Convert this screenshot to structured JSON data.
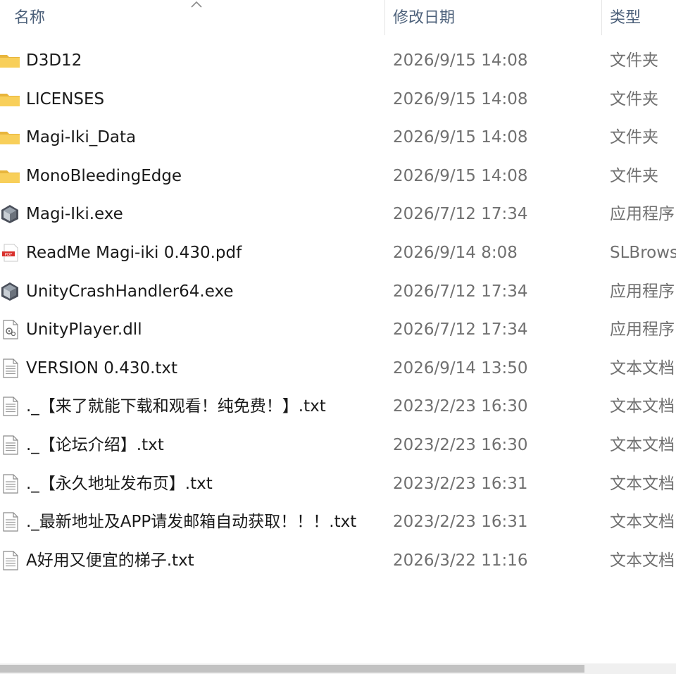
{
  "header": {
    "name_label": "名称",
    "date_label": "修改日期",
    "type_label": "类型",
    "sort_indicator": "chevron-up-icon"
  },
  "files": [
    {
      "name": "D3D12",
      "date": "2026/9/15 14:08",
      "type": "文件夹",
      "icon": "folder"
    },
    {
      "name": "LICENSES",
      "date": "2026/9/15 14:08",
      "type": "文件夹",
      "icon": "folder"
    },
    {
      "name": "Magi-Iki_Data",
      "date": "2026/9/15 14:08",
      "type": "文件夹",
      "icon": "folder"
    },
    {
      "name": "MonoBleedingEdge",
      "date": "2026/9/15 14:08",
      "type": "文件夹",
      "icon": "folder"
    },
    {
      "name": "Magi-Iki.exe",
      "date": "2026/7/12 17:34",
      "type": "应用程序",
      "icon": "unity-exe"
    },
    {
      "name": "ReadMe Magi-iki 0.430.pdf",
      "date": "2026/9/14 8:08",
      "type": "SLBrowse",
      "icon": "pdf"
    },
    {
      "name": "UnityCrashHandler64.exe",
      "date": "2026/7/12 17:34",
      "type": "应用程序",
      "icon": "unity-exe"
    },
    {
      "name": "UnityPlayer.dll",
      "date": "2026/7/12 17:34",
      "type": "应用程序",
      "icon": "dll"
    },
    {
      "name": "VERSION 0.430.txt",
      "date": "2026/9/14 13:50",
      "type": "文本文档",
      "icon": "txt"
    },
    {
      "name": "._【来了就能下载和观看！纯免费！】.txt",
      "date": "2023/2/23 16:30",
      "type": "文本文档",
      "icon": "txt"
    },
    {
      "name": "._【论坛介绍】.txt",
      "date": "2023/2/23 16:30",
      "type": "文本文档",
      "icon": "txt"
    },
    {
      "name": "._【永久地址发布页】.txt",
      "date": "2023/2/23 16:31",
      "type": "文本文档",
      "icon": "txt"
    },
    {
      "name": "._最新地址及APP请发邮箱自动获取！！！.txt",
      "date": "2023/2/23 16:31",
      "type": "文本文档",
      "icon": "txt"
    },
    {
      "name": "A好用又便宜的梯子.txt",
      "date": "2026/3/22 11:16",
      "type": "文本文档",
      "icon": "txt"
    }
  ]
}
